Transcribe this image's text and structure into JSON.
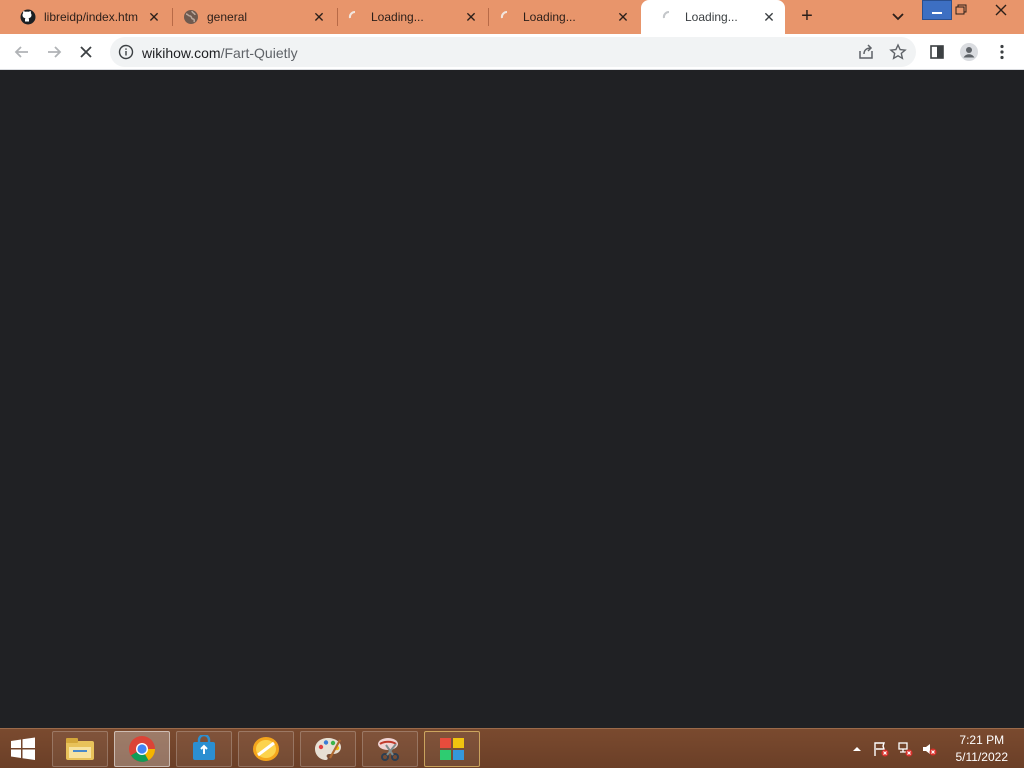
{
  "tabs": [
    {
      "title": "libreidp/index.html",
      "icon": "github-icon"
    },
    {
      "title": "general",
      "icon": "globe-icon"
    },
    {
      "title": "Loading...",
      "icon": "loading-spinner-icon"
    },
    {
      "title": "Loading...",
      "icon": "loading-spinner-icon"
    },
    {
      "title": "Loading...",
      "icon": "loading-spinner-icon",
      "active": true
    }
  ],
  "address_bar": {
    "domain": "wikihow.com",
    "path": "/Fart-Quietly"
  },
  "colors": {
    "tabstrip": "#e8956b",
    "content": "#202124",
    "taskbar": "#6b3f27"
  },
  "taskbar": {
    "apps": [
      "file-explorer-icon",
      "chrome-icon",
      "store-icon",
      "orange-app-icon",
      "paint-palette-icon",
      "scissors-app-icon",
      "windows-tiles-icon"
    ],
    "tray_icons": [
      "show-hidden-icons-chevron",
      "action-center-flag-icon",
      "network-icon",
      "volume-muted-icon"
    ],
    "time": "7:21 PM",
    "date": "5/11/2022"
  }
}
